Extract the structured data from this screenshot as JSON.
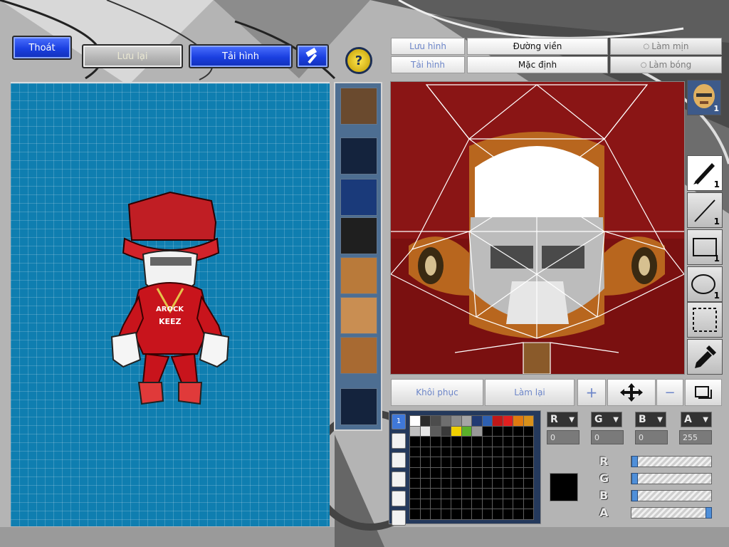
{
  "toolbar": {
    "exit_label": "Thoát",
    "save_label": "Lưu lại",
    "load_label": "Tải hình",
    "help_label": "?"
  },
  "editor_tabs": {
    "save_image": "Lưu hình",
    "outline": "Đường viền",
    "smooth": "Làm mịn",
    "load_image": "Tải hình",
    "default": "Mặc định",
    "shade": "Làm bóng"
  },
  "character": {
    "shirt_text_line1": "AROCK",
    "shirt_text_line2": "KEEZ"
  },
  "tools": {
    "brush_count": "1",
    "line_count": "1",
    "rect_count": "1",
    "ellipse_count": "1",
    "face_count": "1"
  },
  "bottom_buttons": {
    "restore": "Khôi phục",
    "redo": "Làm lại"
  },
  "palette": {
    "tab_selected": "1",
    "colors": [
      "#ffffff",
      "#2b2b2b",
      "#4c4c4c",
      "#6e6e6e",
      "#8a8a8a",
      "#a5a5a5",
      "#203a73",
      "#2d5fb0",
      "#c01818",
      "#e02020",
      "#e07a10",
      "#d8901a",
      "#bfbfbf",
      "#e6e6e6",
      "#5c5c5c",
      "#3a3a3a"
    ],
    "extra_colors": [
      "#f0d000",
      "#5ab02a",
      "#999999"
    ]
  },
  "color_channels": {
    "r_label": "R",
    "g_label": "G",
    "b_label": "B",
    "a_label": "A",
    "r_value": "0",
    "g_value": "0",
    "b_value": "0",
    "a_value": "255",
    "current_color": "#000000"
  },
  "sliders": {
    "r": 0,
    "g": 0,
    "b": 0,
    "a": 1
  }
}
